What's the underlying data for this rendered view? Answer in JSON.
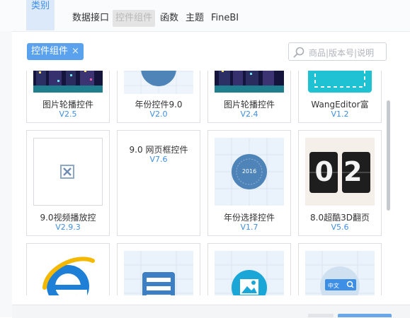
{
  "header": {
    "category_label": "类别",
    "tabs": [
      {
        "label": "数据接口",
        "active": false
      },
      {
        "label": "控件组件",
        "active": true
      },
      {
        "label": "函数",
        "active": false
      },
      {
        "label": "主题",
        "active": false
      },
      {
        "label": "FineBI",
        "active": false
      }
    ]
  },
  "filter": {
    "chip_label": "控件组件",
    "chip_close": "×"
  },
  "search": {
    "placeholder": "商品|版本号|说明",
    "icon": "search-icon"
  },
  "cards": [
    {
      "name": "图片轮播控件",
      "version": "V2.5",
      "thumb": "city-night"
    },
    {
      "name": "年份控件9.0",
      "version": "V2.0",
      "thumb": "year-circle"
    },
    {
      "name": "图片轮播控件",
      "version": "V2.4",
      "thumb": "city-night"
    },
    {
      "name": "WangEditor富",
      "version": "V1.2",
      "thumb": "editor"
    },
    {
      "name": "9.0视频播放控",
      "version": "V2.9.3",
      "thumb": "broken-image"
    },
    {
      "name": "9.0 网页框控件",
      "version": "V7.6",
      "thumb": "none"
    },
    {
      "name": "年份选择控件",
      "version": "V1.7",
      "thumb": "year-select",
      "thumb_text": "2016"
    },
    {
      "name": "8.0超酷3D翻页",
      "version": "V5.6",
      "thumb": "flip-clock",
      "thumb_text": "02"
    },
    {
      "name": "",
      "version": "",
      "thumb": "ie-logo"
    },
    {
      "name": "",
      "version": "",
      "thumb": "list-widget"
    },
    {
      "name": "",
      "version": "",
      "thumb": "image-widget"
    },
    {
      "name": "",
      "version": "",
      "thumb": "search-widget",
      "thumb_text": "中文"
    }
  ],
  "colors": {
    "accent": "#3d8ee5",
    "chip": "#5aa2ee",
    "category_bg": "#dbe9fb"
  }
}
